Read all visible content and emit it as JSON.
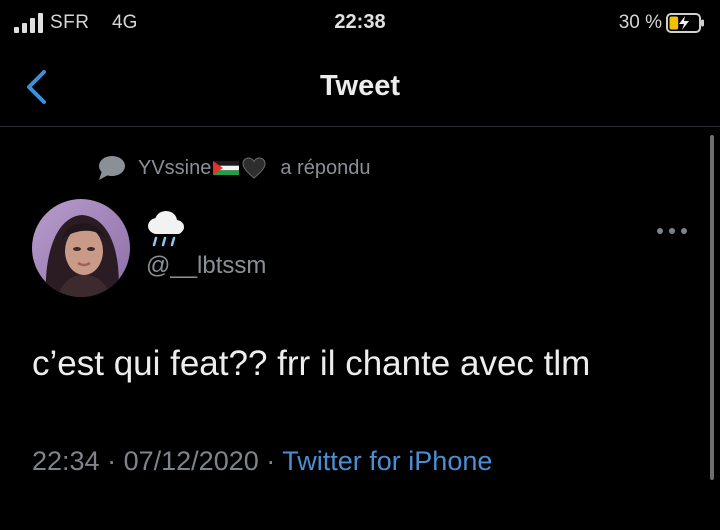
{
  "status_bar": {
    "carrier": "SFR",
    "network": "4G",
    "time": "22:38",
    "battery_percent": "30 %",
    "battery_level": 0.3,
    "icons": [
      "signal-icon",
      "battery-charging-icon"
    ]
  },
  "nav": {
    "back_icon": "chevron-left-icon",
    "title": "Tweet"
  },
  "reply_context": {
    "icon": "speech-bubble-icon",
    "name": "YVssine",
    "name_icons": [
      "palestine-flag-icon",
      "black-heart-icon"
    ],
    "action": "a répondu"
  },
  "tweet": {
    "avatar": "avatar-photo",
    "display_name_icon": "cloud-with-rain-icon",
    "handle": "@__lbtssm",
    "more_icon": "more-dots-icon",
    "text": "c’est qui feat?? frr il chante avec tlm",
    "time": "22:34",
    "separator": "·",
    "date": "07/12/2020",
    "source": "Twitter for iPhone"
  },
  "colors": {
    "background": "#000000",
    "primary_text": "#e7e9ea",
    "secondary_text": "#8b9096",
    "link": "#4a8fd4"
  }
}
